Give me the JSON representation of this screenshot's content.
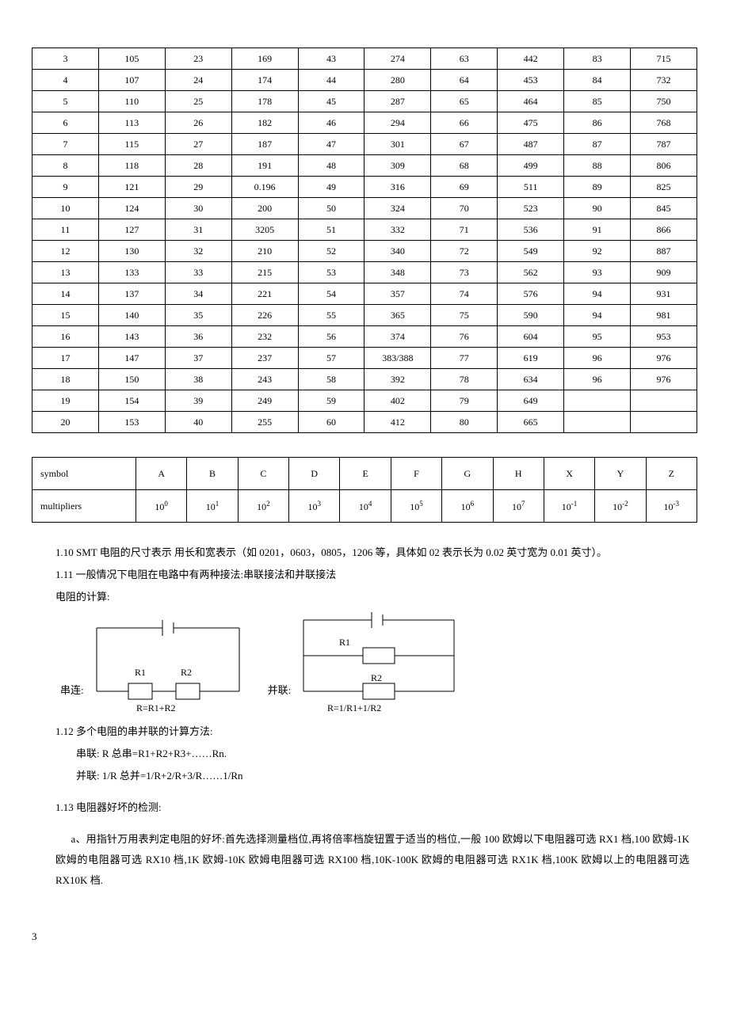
{
  "main_table": {
    "rows": [
      [
        "3",
        "105",
        "23",
        "169",
        "43",
        "274",
        "63",
        "442",
        "83",
        "715"
      ],
      [
        "4",
        "107",
        "24",
        "174",
        "44",
        "280",
        "64",
        "453",
        "84",
        "732"
      ],
      [
        "5",
        "110",
        "25",
        "178",
        "45",
        "287",
        "65",
        "464",
        "85",
        "750"
      ],
      [
        "6",
        "113",
        "26",
        "182",
        "46",
        "294",
        "66",
        "475",
        "86",
        "768"
      ],
      [
        "7",
        "115",
        "27",
        "187",
        "47",
        "301",
        "67",
        "487",
        "87",
        "787"
      ],
      [
        "8",
        "118",
        "28",
        "191",
        "48",
        "309",
        "68",
        "499",
        "88",
        "806"
      ],
      [
        "9",
        "121",
        "29",
        "0.196",
        "49",
        "316",
        "69",
        "511",
        "89",
        "825"
      ],
      [
        "10",
        "124",
        "30",
        "200",
        "50",
        "324",
        "70",
        "523",
        "90",
        "845"
      ],
      [
        "11",
        "127",
        "31",
        "3205",
        "51",
        "332",
        "71",
        "536",
        "91",
        "866"
      ],
      [
        "12",
        "130",
        "32",
        "210",
        "52",
        "340",
        "72",
        "549",
        "92",
        "887"
      ],
      [
        "13",
        "133",
        "33",
        "215",
        "53",
        "348",
        "73",
        "562",
        "93",
        "909"
      ],
      [
        "14",
        "137",
        "34",
        "221",
        "54",
        "357",
        "74",
        "576",
        "94",
        "931"
      ],
      [
        "15",
        "140",
        "35",
        "226",
        "55",
        "365",
        "75",
        "590",
        "94",
        "981"
      ],
      [
        "16",
        "143",
        "36",
        "232",
        "56",
        "374",
        "76",
        "604",
        "95",
        "953"
      ],
      [
        "17",
        "147",
        "37",
        "237",
        "57",
        "383/388",
        "77",
        "619",
        "96",
        "976"
      ],
      [
        "18",
        "150",
        "38",
        "243",
        "58",
        "392",
        "78",
        "634",
        "96",
        "976"
      ],
      [
        "19",
        "154",
        "39",
        "249",
        "59",
        "402",
        "79",
        "649",
        "",
        ""
      ],
      [
        "20",
        "153",
        "40",
        "255",
        "60",
        "412",
        "80",
        "665",
        "",
        ""
      ]
    ]
  },
  "mult_table": {
    "symbol_label": "symbol",
    "mult_label": "multipliers",
    "symbols": [
      "A",
      "B",
      "C",
      "D",
      "E",
      "F",
      "G",
      "H",
      "X",
      "Y",
      "Z"
    ],
    "exponents": [
      "0",
      "1",
      "2",
      "3",
      "4",
      "5",
      "6",
      "7",
      "-1",
      "-2",
      "-3"
    ]
  },
  "text": {
    "p110": "1.10  SMT 电阻的尺寸表示 用长和宽表示（如 0201，0603，0805，1206 等，具体如 02 表示长为 0.02 英寸宽为 0.01 英寸）。",
    "p111": "1.11 一般情况下电阻在电路中有两种接法:串联接法和并联接法",
    "calc_label": "电阻的计算:",
    "series_label": "串连:",
    "parallel_label": "并联:",
    "series_formula": "R=R1+R2",
    "parallel_formula": "R=1/R1+1/R2",
    "p112": "1.12  多个电阻的串并联的计算方法:",
    "series_multi": "串联: R 总串=R1+R2+R3+……Rn.",
    "parallel_multi": "并联: 1/R 总并=1/R+2/R+3/R……1/Rn",
    "p113": "1.13  电阻器好坏的检测:",
    "p113a": "a、用指针万用表判定电阻的好坏:首先选择测量档位,再将倍率档旋钮置于适当的档位,一般 100 欧姆以下电阻器可选 RX1 档,100 欧姆-1K 欧姆的电阻器可选 RX10 档,1K 欧姆-10K 欧姆电阻器可选 RX100 档,10K-100K 欧姆的电阻器可选 RX1K 档,100K 欧姆以上的电阻器可选 RX10K 档."
  },
  "svg": {
    "r1": "R1",
    "r2": "R2"
  },
  "page_number": "3"
}
